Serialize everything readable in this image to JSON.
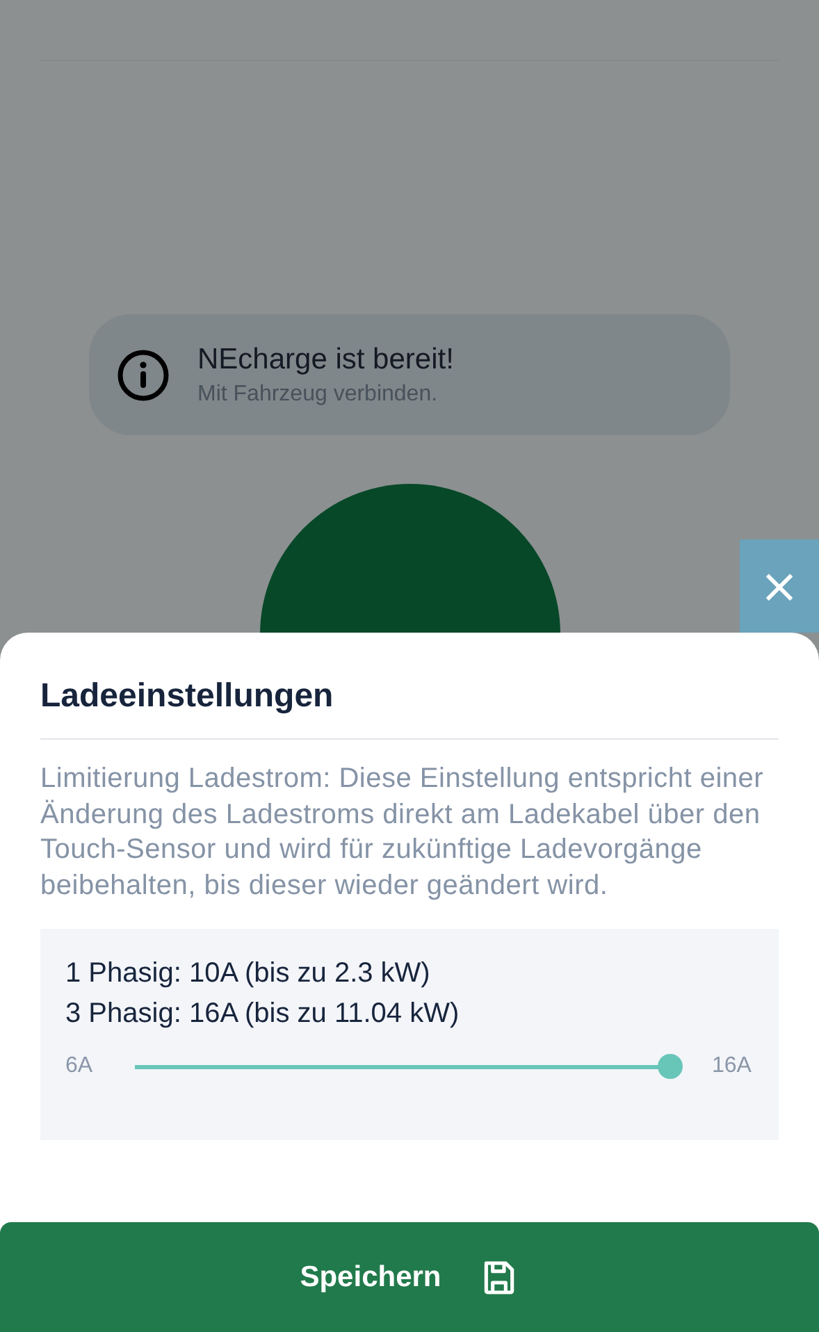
{
  "notice": {
    "title": "NEcharge ist bereit!",
    "subtitle": "Mit Fahrzeug verbinden."
  },
  "close_button": "×",
  "sheet": {
    "title": "Ladeeinstellungen",
    "description": "Limitierung Ladestrom: Diese Einstellung entspricht einer Änderung des Ladestroms direkt am Ladekabel über den Touch-Sensor und wird für zukünftige Ladevorgänge beibehalten, bis dieser wieder geändert wird.",
    "phases": [
      "1 Phasig: 10A (bis zu 2.3 kW)",
      "3 Phasig: 16A (bis zu 11.04 kW)"
    ],
    "slider": {
      "min_label": "6A",
      "max_label": "16A",
      "level": 1
    },
    "save_button": "Speichern"
  }
}
